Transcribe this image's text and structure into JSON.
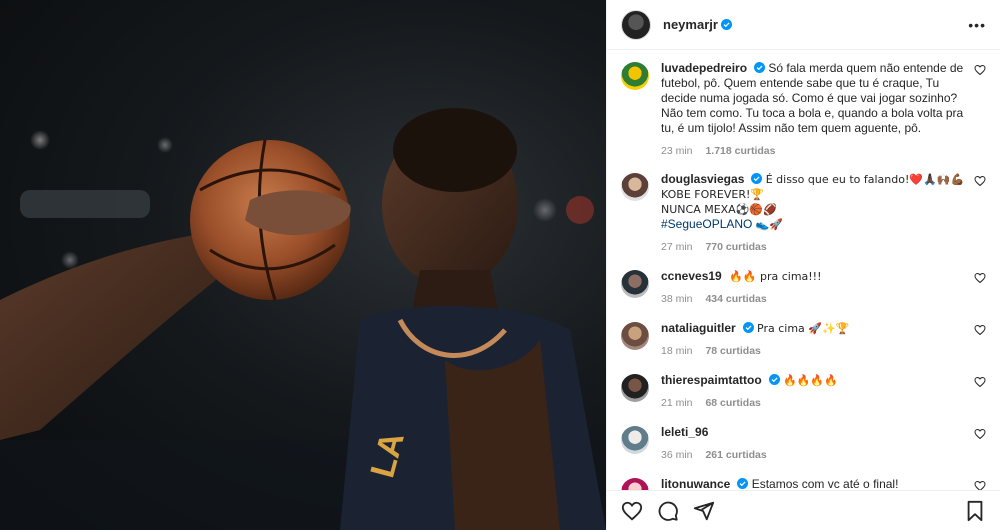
{
  "post": {
    "author": "neymarjr"
  },
  "comments": [
    {
      "user": "luvadepedreiro",
      "verified": true,
      "text": "Só fala merda quem não entende de futebol, pô. Quem entende sabe que tu é craque, Tu decide numa jogada só. Como é que vai jogar sozinho? Não tem como. Tu toca a bola e, quando a bola volta pra tu, é um tijolo! Assim não tem quem aguente, pô.",
      "time": "23 min",
      "likes": "1.718 curtidas"
    },
    {
      "user": "douglasviegas",
      "verified": true,
      "line1": "É disso que eu to falando!❤️🙏🏿🙌🏾💪🏾",
      "line2": "KOBE FOREVER!🏆",
      "line3": "NUNCA MEXA⚽🏀🏈",
      "hashtag": "#SegueOPLANO",
      "line4_emoji": "👟🚀",
      "time": "27 min",
      "likes": "770 curtidas"
    },
    {
      "user": "ccneves19",
      "verified": false,
      "text": "🔥🔥 pra cima!!!",
      "time": "38 min",
      "likes": "434 curtidas"
    },
    {
      "user": "nataliaguitler",
      "verified": true,
      "text": "Pra cima 🚀✨🏆",
      "time": "18 min",
      "likes": "78 curtidas"
    },
    {
      "user": "thierespaimtattoo",
      "verified": true,
      "text": "🔥🔥🔥🔥",
      "time": "21 min",
      "likes": "68 curtidas"
    },
    {
      "user": "leleti_96",
      "verified": false,
      "text": "",
      "time": "36 min",
      "likes": "261 curtidas"
    },
    {
      "user": "litonuwance",
      "verified": true,
      "text": "Estamos com vc até o final!",
      "time": "",
      "likes": ""
    }
  ],
  "icons": {
    "more": "more-options-icon",
    "like": "heart-icon",
    "comment": "comment-icon",
    "share": "share-icon",
    "save": "bookmark-icon",
    "verified": "verified-badge-icon"
  },
  "colors": {
    "verified": "#0095f6",
    "text": "#262626",
    "meta": "#8e8e8e",
    "hashtag": "#00376b"
  }
}
